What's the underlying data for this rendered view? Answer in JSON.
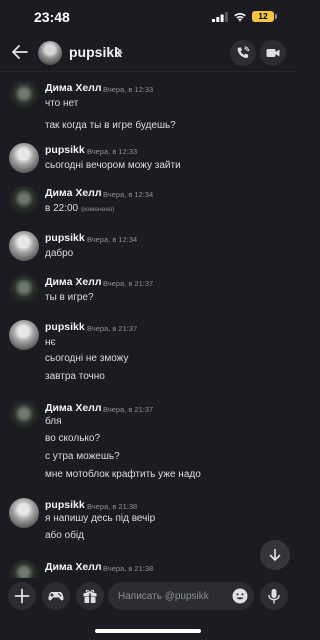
{
  "status": {
    "time": "23:48",
    "battery": "12"
  },
  "header": {
    "title": "pupsikk"
  },
  "messages": [
    {
      "author": "Дима Хелл",
      "timestamp": "Вчера, в 12:33",
      "lines": [
        "что нет",
        "так когда ты в игре будешь?"
      ]
    },
    {
      "author": "pupsikk",
      "timestamp": "Вчера, в 12:33",
      "lines": [
        "сьогодні вечором можу зайти"
      ]
    },
    {
      "author": "Дима Хелл",
      "timestamp": "Вчера, в 12:34",
      "lines": [
        "в 22:00"
      ],
      "edited": "(изменено)"
    },
    {
      "author": "pupsikk",
      "timestamp": "Вчера, в 12:34",
      "lines": [
        "дабро"
      ]
    },
    {
      "author": "Дима Хелл",
      "timestamp": "Вчера, в 21:37",
      "lines": [
        "ты в игре?"
      ]
    },
    {
      "author": "pupsikk",
      "timestamp": "Вчера, в 21:37",
      "lines": [
        "нє",
        "сьогодні не зможу",
        "завтра точно"
      ]
    },
    {
      "author": "Дима Хелл",
      "timestamp": "Вчера, в 21:37",
      "lines": [
        "бля",
        "во сколько?",
        "с утра можешь?",
        "мне мотоблок крафтить уже надо"
      ]
    },
    {
      "author": "pupsikk",
      "timestamp": "Вчера, в 21:38",
      "lines": [
        "я напишу десь під вечір",
        "або обід"
      ]
    },
    {
      "author": "Дима Хелл",
      "timestamp": "Вчера, в 21:38",
      "lines": []
    }
  ],
  "composer": {
    "placeholder": "Написать @pupsikk"
  }
}
